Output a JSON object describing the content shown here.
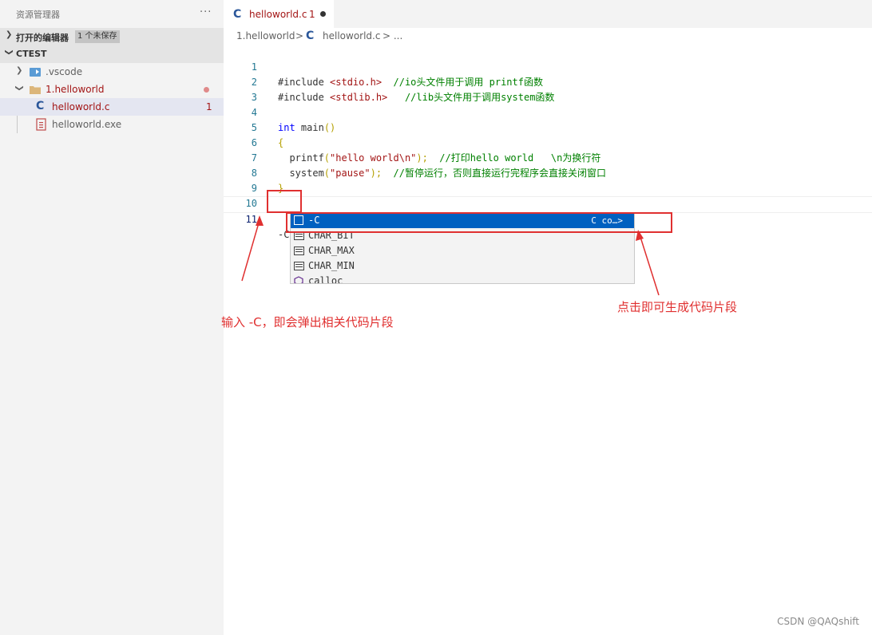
{
  "sidebar": {
    "title": "资源管理器",
    "more": "···",
    "open_editors": {
      "label": "打开的编辑器",
      "badge": "1 个未保存"
    },
    "workspace": {
      "label": "CTEST"
    },
    "items": [
      {
        "label": ".vscode",
        "icon": "vscode-folder-icon"
      },
      {
        "label": "1.helloworld",
        "icon": "folder-open-icon"
      },
      {
        "label": "helloworld.c",
        "icon": "c-file-icon",
        "count": "1"
      },
      {
        "label": "helloworld.exe",
        "icon": "exe-file-icon"
      }
    ]
  },
  "tab": {
    "icon": "C",
    "label": "helloworld.c",
    "num": "1"
  },
  "breadcrumb": {
    "folder": "1.helloworld",
    "sep": ">",
    "icon": "C",
    "file": "helloworld.c",
    "tail": "> ..."
  },
  "editor": {
    "lines": [
      {
        "num": "1",
        "a": "#include ",
        "b": "<stdio.h>",
        "c": "  //io头文件用于调用 printf函数"
      },
      {
        "num": "2",
        "a": "#include ",
        "b": "<stdlib.h>",
        "c": "   //lib头文件用于调用system函数"
      },
      {
        "num": "3"
      },
      {
        "num": "4",
        "kw": "int",
        "rest": " main",
        "p": "()"
      },
      {
        "num": "5",
        "p": "{"
      },
      {
        "num": "6",
        "f": "  printf",
        "p1": "(",
        "s": "\"hello world\\n\"",
        "p2": ");",
        "c": "  //打印hello world   \\n为换行符"
      },
      {
        "num": "7",
        "f": "  system",
        "p1": "(",
        "s": "\"pause\"",
        "p2": ");",
        "c": "  //暂停运行，否则直接运行完程序会直接关闭窗口"
      },
      {
        "num": "8",
        "p": "}"
      },
      {
        "num": "9"
      },
      {
        "num": "10"
      },
      {
        "num": "11",
        "text": "-C"
      }
    ]
  },
  "suggest": {
    "items": [
      {
        "label": "-C",
        "detail": "C co…>"
      },
      {
        "label": "CHAR_BIT"
      },
      {
        "label": "CHAR_MAX"
      },
      {
        "label": "CHAR_MIN"
      },
      {
        "label": "calloc"
      }
    ]
  },
  "annotations": {
    "left": "输入 -C，即会弹出相关代码片段",
    "right": "点击即可生成代码片段"
  },
  "watermark": "CSDN @QAQshift",
  "colors": {
    "annotation": "#e03030",
    "selection": "#0060c0",
    "c_icon": "#2b579a"
  }
}
